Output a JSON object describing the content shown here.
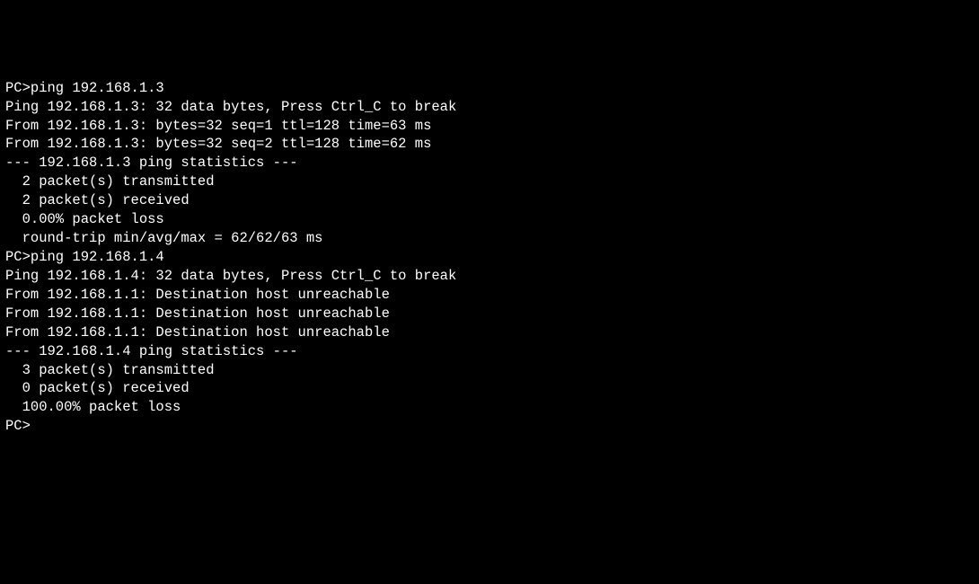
{
  "lines": {
    "l1": "PC>ping 192.168.1.3",
    "l2": "",
    "l3": "Ping 192.168.1.3: 32 data bytes, Press Ctrl_C to break",
    "l4": "From 192.168.1.3: bytes=32 seq=1 ttl=128 time=63 ms",
    "l5": "From 192.168.1.3: bytes=32 seq=2 ttl=128 time=62 ms",
    "l6": "",
    "l7": "--- 192.168.1.3 ping statistics ---",
    "l8": "  2 packet(s) transmitted",
    "l9": "  2 packet(s) received",
    "l10": "  0.00% packet loss",
    "l11": "  round-trip min/avg/max = 62/62/63 ms",
    "l12": "",
    "l13": "PC>ping 192.168.1.4",
    "l14": "",
    "l15": "Ping 192.168.1.4: 32 data bytes, Press Ctrl_C to break",
    "l16": "From 192.168.1.1: Destination host unreachable",
    "l17": "From 192.168.1.1: Destination host unreachable",
    "l18": "From 192.168.1.1: Destination host unreachable",
    "l19": "",
    "l20": "--- 192.168.1.4 ping statistics ---",
    "l21": "  3 packet(s) transmitted",
    "l22": "  0 packet(s) received",
    "l23": "  100.00% packet loss",
    "l24": "",
    "l25": "PC>"
  }
}
